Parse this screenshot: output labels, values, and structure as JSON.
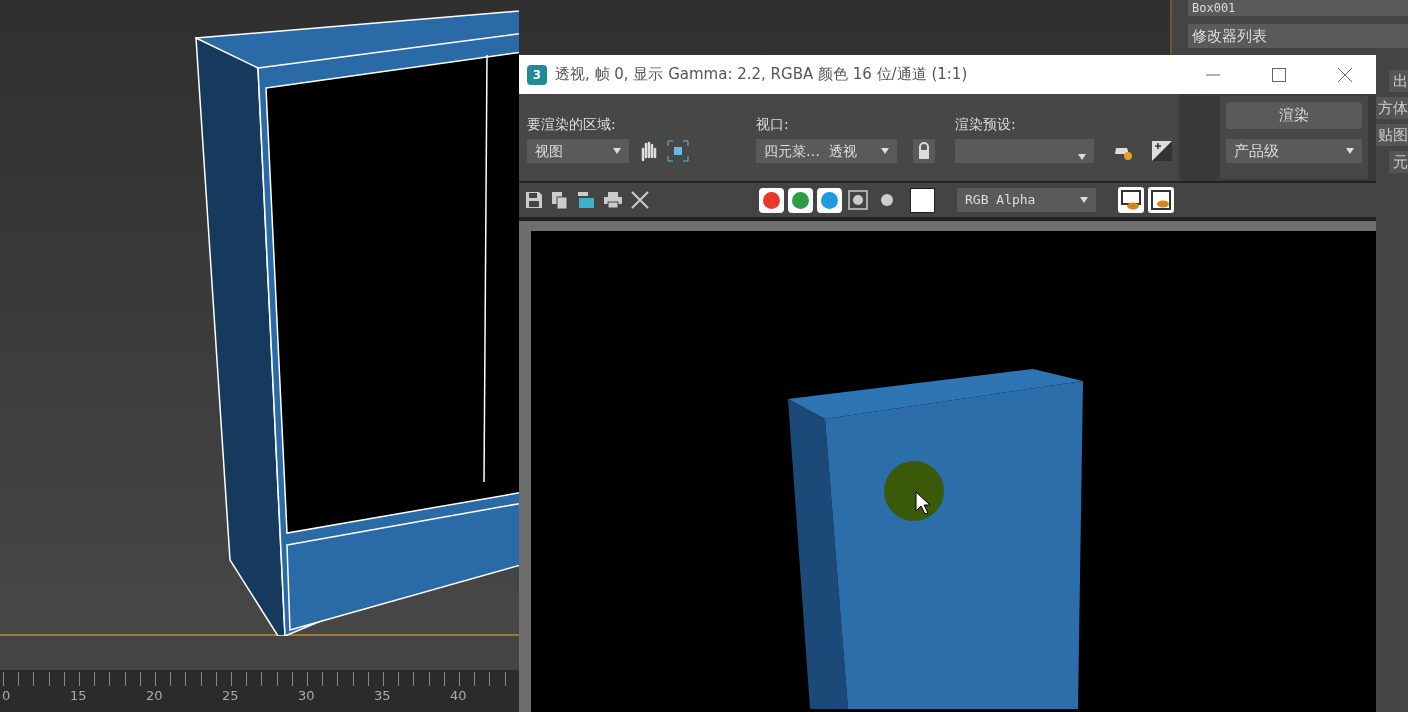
{
  "command_panel": {
    "object_name": "Box001",
    "modifier_list": "修改器列表",
    "partial_labels": [
      "出",
      "方体",
      "贴图",
      "元"
    ]
  },
  "timeline": {
    "labels": [
      "0",
      "15",
      "20",
      "25",
      "30",
      "35",
      "40"
    ]
  },
  "render_window": {
    "app_icon": "3",
    "title": "透视, 帧 0, 显示 Gamma: 2.2, RGBA 颜色 16 位/通道 (1:1)",
    "area": {
      "label": "要渲染的区域:",
      "value": "视图"
    },
    "viewport": {
      "label": "视口:",
      "value": "四元菜…  透视"
    },
    "preset": {
      "label": "渲染预设:"
    },
    "render_button": "渲染",
    "quality": "产品级",
    "channels": [
      {
        "color": "#e53a2a",
        "on": true
      },
      {
        "color": "#2e9c44",
        "on": true
      },
      {
        "color": "#1e9be0",
        "on": true
      }
    ],
    "display_channel": "RGB Alpha"
  }
}
